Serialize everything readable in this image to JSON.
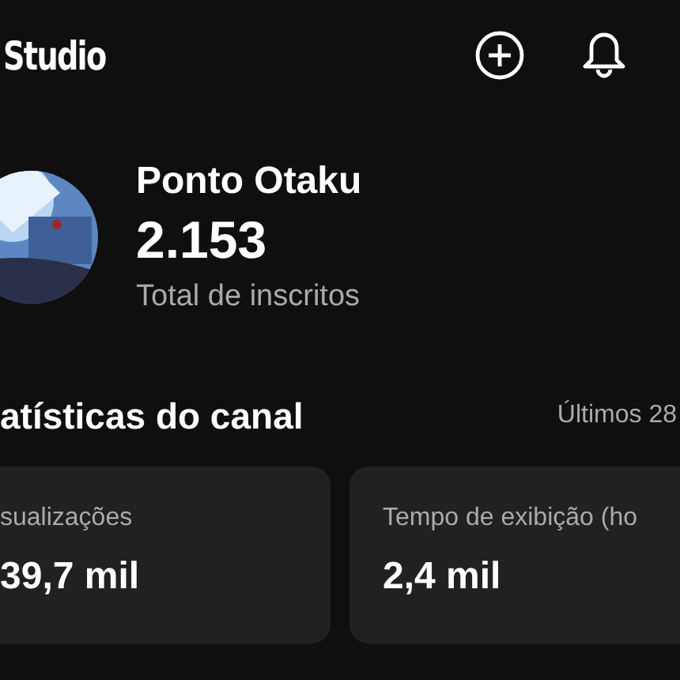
{
  "header": {
    "title": "Studio"
  },
  "channel": {
    "name": "Ponto Otaku",
    "subscribers": "2.153",
    "subscribers_label": "Total de inscritos"
  },
  "stats": {
    "title": "atísticas do canal",
    "period": "Últimos 28",
    "cards": [
      {
        "label": "sualizações",
        "value": "39,7 mil"
      },
      {
        "label": "Tempo de exibição (ho",
        "value": "2,4 mil"
      }
    ]
  }
}
